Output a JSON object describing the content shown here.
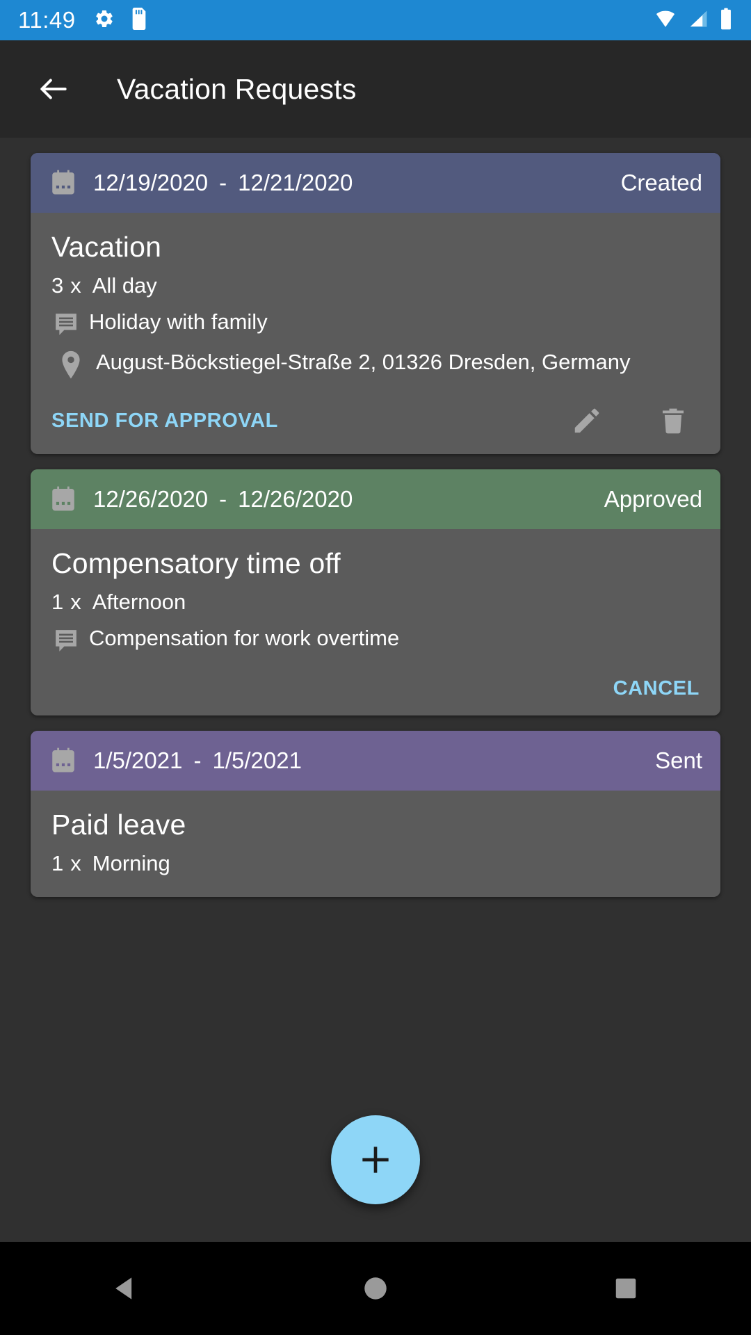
{
  "status_bar": {
    "time": "11:49",
    "left_icons": [
      "gear-icon",
      "sd-card-icon"
    ],
    "right_icons": [
      "wifi-icon",
      "cellular-signal-icon",
      "battery-icon"
    ],
    "background_color": "#1e88d2"
  },
  "app_bar": {
    "back_icon": "back-arrow-icon",
    "title": "Vacation Requests"
  },
  "colors": {
    "accent": "#8ed6f7",
    "screen_background": "#303030",
    "card_body": "#5b5b5b",
    "status_created": "#525a7e",
    "status_approved": "#5d8263",
    "status_sent": "#6e6292"
  },
  "requests": [
    {
      "calendar_icon": "calendar-icon",
      "start_date": "12/19/2020",
      "separator": "-",
      "end_date": "12/21/2020",
      "status": "Created",
      "header_color": "#525a7e",
      "type": "Vacation",
      "count": "3",
      "multiplier": "x",
      "duration": "All day",
      "note_icon": "note-icon",
      "note": "Holiday with family",
      "location_icon": "location-pin-icon",
      "location": "August-Böckstiegel-Straße 2, 01326 Dresden, Germany",
      "primary_action": "SEND FOR APPROVAL",
      "edit_icon": "edit-pencil-icon",
      "delete_icon": "delete-trash-icon"
    },
    {
      "calendar_icon": "calendar-icon",
      "start_date": "12/26/2020",
      "separator": "-",
      "end_date": "12/26/2020",
      "status": "Approved",
      "header_color": "#5d8263",
      "type": "Compensatory time off",
      "count": "1",
      "multiplier": "x",
      "duration": "Afternoon",
      "note_icon": "note-icon",
      "note": "Compensation for work overtime",
      "primary_action": "CANCEL"
    },
    {
      "calendar_icon": "calendar-icon",
      "start_date": "1/5/2021",
      "separator": "-",
      "end_date": "1/5/2021",
      "status": "Sent",
      "header_color": "#6e6292",
      "type": "Paid leave",
      "count": "1",
      "multiplier": "x",
      "duration": "Morning"
    }
  ],
  "fab": {
    "icon": "plus-icon",
    "label": "+"
  },
  "nav_bar": {
    "back": "nav-back-triangle-icon",
    "home": "nav-home-circle-icon",
    "recents": "nav-recents-square-icon"
  }
}
